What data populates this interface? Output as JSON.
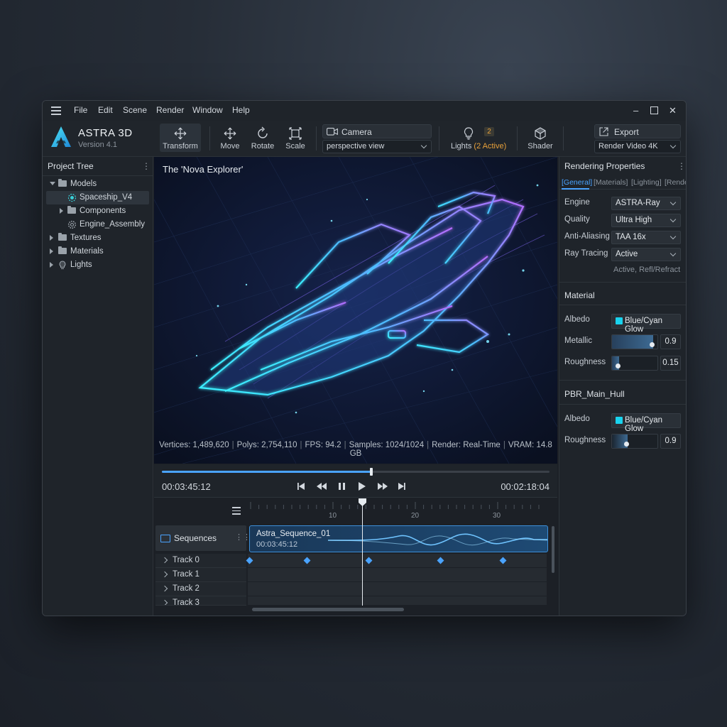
{
  "menu": [
    "File",
    "Edit",
    "Scene",
    "Render",
    "Window",
    "Help"
  ],
  "app": {
    "name": "ASTRA 3D",
    "version": "Version 4.1"
  },
  "toolbar": {
    "transform": "Transform",
    "move": "Move",
    "rotate": "Rotate",
    "scale": "Scale",
    "camera_label": "Camera",
    "camera_value": "perspective view",
    "lights_label": "Lights",
    "lights_active": "(2 Active)",
    "lights_badge": "2",
    "shader": "Shader",
    "export_label": "Export",
    "export_value": "Render Video 4K"
  },
  "project_tree": {
    "title": "Project Tree",
    "items": [
      {
        "label": "Models"
      },
      {
        "label": "Spaceship_V4"
      },
      {
        "label": "Components"
      },
      {
        "label": "Engine_Assembly"
      },
      {
        "label": "Textures"
      },
      {
        "label": "Materials"
      },
      {
        "label": "Lights"
      }
    ]
  },
  "viewport": {
    "title": "The 'Nova Explorer'",
    "stats": {
      "vertices": "Vertices: 1,489,620",
      "polys": "Polys: 2,754,110",
      "fps": "FPS: 94.2",
      "samples": "Samples: 1024/1024",
      "render": "Render: Real-Time",
      "vram": "VRAM: 14.8 GB"
    }
  },
  "transport": {
    "current_time": "00:03:45:12",
    "total_time": "00:02:18:04",
    "progress": 0.54
  },
  "timeline": {
    "ruler": [
      "10",
      "20",
      "30"
    ],
    "sequences_label": "Sequences",
    "clip_name": "Astra_Sequence_01",
    "clip_time": "00:03:45:12",
    "tracks": [
      "Track 0",
      "Track 1",
      "Track 2",
      "Track 3"
    ]
  },
  "rendering": {
    "title": "Rendering Properties",
    "tabs": [
      "[General]",
      "[Materials]",
      "[Lighting]",
      "[Rende"
    ],
    "engine_label": "Engine",
    "engine_value": "ASTRA-Ray",
    "quality_label": "Quality",
    "quality_value": "Ultra High",
    "aa_label": "Anti-Aliasing",
    "aa_value": "TAA 16x",
    "rt_label": "Ray Tracing",
    "rt_value": "Active",
    "rt_note": "Active, Refl/Refract"
  },
  "material": {
    "title": "Material",
    "albedo_label": "Albedo",
    "albedo_value": "Blue/Cyan Glow",
    "metallic_label": "Metallic",
    "metallic_value": "0.9",
    "metallic_level": 0.9,
    "roughness_label": "Roughness",
    "roughness_value": "0.15",
    "roughness_level": 0.15
  },
  "pbr": {
    "title": "PBR_Main_Hull",
    "albedo_label": "Albedo",
    "albedo_value": "Blue/Cyan Glow",
    "roughness_label": "Roughness",
    "roughness_value": "0.9",
    "roughness_level": 0.35
  },
  "colors": {
    "accent": "#4aa3ff",
    "cyan": "#19d3ee",
    "badge": "#e8a13a"
  }
}
